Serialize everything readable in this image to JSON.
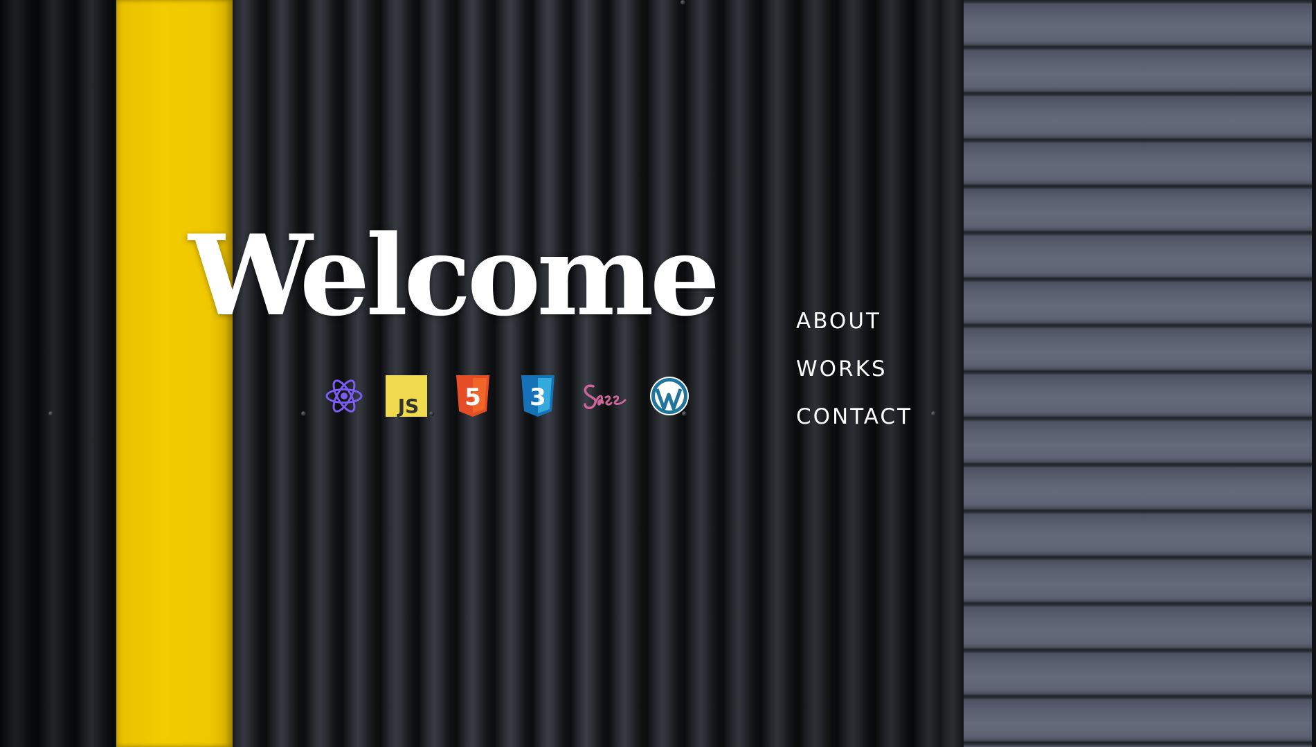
{
  "hero": {
    "heading": "Welcome"
  },
  "tech_icons": [
    {
      "name": "react-icon",
      "color": "#7a5cf0"
    },
    {
      "name": "javascript-icon",
      "label": "JS",
      "color": "#f0db4f"
    },
    {
      "name": "html5-icon",
      "label": "5",
      "color": "#e44d26"
    },
    {
      "name": "css3-icon",
      "label": "3",
      "color": "#2965f1"
    },
    {
      "name": "sass-icon",
      "color": "#cc6699"
    },
    {
      "name": "wordpress-icon",
      "color": "#21759b"
    }
  ],
  "nav": {
    "items": [
      {
        "label": "ABOUT"
      },
      {
        "label": "WORKS"
      },
      {
        "label": "CONTACT"
      }
    ]
  },
  "colors": {
    "accent_yellow": "#f0c800",
    "text": "#ffffff"
  }
}
